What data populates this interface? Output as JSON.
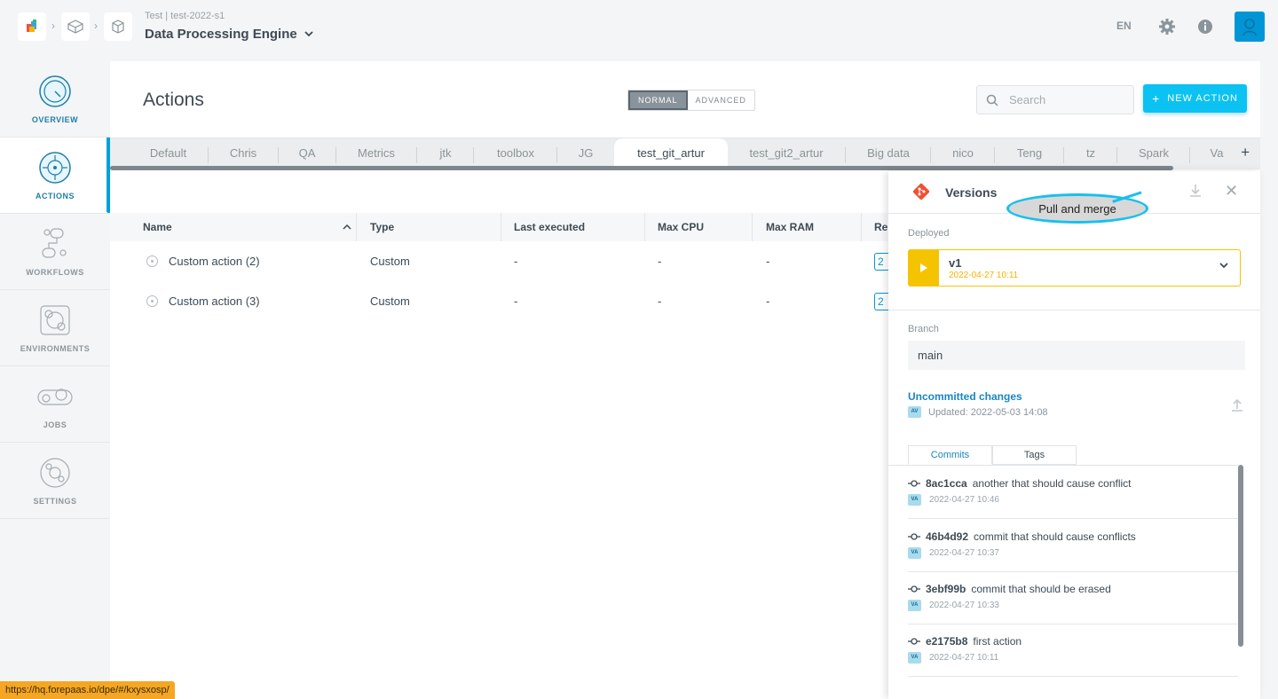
{
  "header": {
    "breadcrumb_sub": "Test | test-2022-s1",
    "app_name": "Data Processing Engine",
    "language": "EN"
  },
  "sidebar": {
    "items": [
      {
        "label": "OVERVIEW",
        "icon": "gauge-icon"
      },
      {
        "label": "ACTIONS",
        "icon": "target-icon"
      },
      {
        "label": "WORKFLOWS",
        "icon": "workflow-icon"
      },
      {
        "label": "ENVIRONMENTS",
        "icon": "environment-icon"
      },
      {
        "label": "JOBS",
        "icon": "jobs-icon"
      },
      {
        "label": "SETTINGS",
        "icon": "settings-icon"
      }
    ]
  },
  "page": {
    "title": "Actions",
    "mode_normal": "NORMAL",
    "mode_advanced": "ADVANCED",
    "search_placeholder": "Search",
    "new_action_label": "NEW ACTION"
  },
  "tabs": [
    "Default",
    "Chris",
    "QA",
    "Metrics",
    "jtk",
    "toolbox",
    "JG",
    "test_git_artur",
    "test_git2_artur",
    "Big data",
    "nico",
    "Teng",
    "tz",
    "Spark",
    "Va"
  ],
  "table": {
    "headers": [
      "Name",
      "Type",
      "Last executed",
      "Max CPU",
      "Max RAM",
      "Re"
    ],
    "rows": [
      {
        "name": "Custom action (2)",
        "type": "Custom",
        "last": "-",
        "cpu": "-",
        "ram": "-",
        "res": "2"
      },
      {
        "name": "Custom action (3)",
        "type": "Custom",
        "last": "-",
        "cpu": "-",
        "ram": "-",
        "res": "2"
      }
    ]
  },
  "versions": {
    "title": "Versions",
    "tooltip": "Pull and merge",
    "deployed_label": "Deployed",
    "deployed_version": "v1",
    "deployed_date": "2022-04-27 10:11",
    "branch_label": "Branch",
    "branch_value": "main",
    "uncommitted_title": "Uncommitted changes",
    "uncommitted_user": "AV",
    "uncommitted_updated": "Updated: 2022-05-03 14:08",
    "tab_commits": "Commits",
    "tab_tags": "Tags",
    "commits": [
      {
        "hash": "8ac1cca",
        "message": "another that should cause conflict",
        "user": "VA",
        "date": "2022-04-27 10:46"
      },
      {
        "hash": "46b4d92",
        "message": "commit that should cause conflicts",
        "user": "VA",
        "date": "2022-04-27 10:37"
      },
      {
        "hash": "3ebf99b",
        "message": "commit that should be erased",
        "user": "VA",
        "date": "2022-04-27 10:33"
      },
      {
        "hash": "e2175b8",
        "message": "first action",
        "user": "VA",
        "date": "2022-04-27 10:11"
      }
    ]
  },
  "status_url": "https://hq.forepaas.io/dpe/#/kxysxosp/",
  "colors": {
    "accent": "#0bc2f2",
    "deployed": "#f5c400",
    "link": "#1a86c0"
  }
}
